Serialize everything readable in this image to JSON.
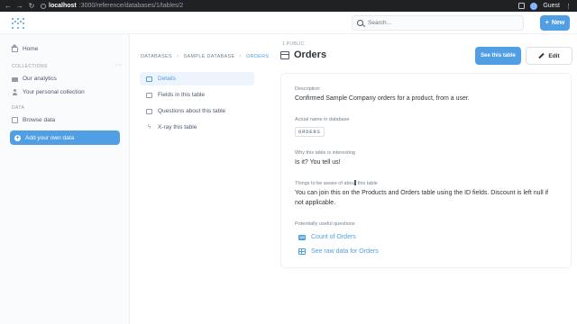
{
  "browser": {
    "host": "localhost",
    "path": ":3000/reference/databases/1/tables/2",
    "profile": "Guest"
  },
  "header": {
    "search_placeholder": "Search…",
    "new_label": "New"
  },
  "sidebar": {
    "home": "Home",
    "collections_heading": "COLLECTIONS",
    "collections": [
      {
        "label": "Our analytics",
        "icon": "folder-icon"
      },
      {
        "label": "Your personal collection",
        "icon": "person-icon"
      }
    ],
    "data_heading": "DATA",
    "browse_data": "Browse data",
    "add_data": "Add your own data"
  },
  "breadcrumb": [
    "DATABASES",
    "SAMPLE DATABASE",
    "ORDERS"
  ],
  "ref_nav": [
    {
      "label": "Details",
      "selected": true
    },
    {
      "label": "Fields in this table",
      "selected": false
    },
    {
      "label": "Questions about this table",
      "selected": false
    },
    {
      "label": "X-ray this table",
      "selected": false
    }
  ],
  "table": {
    "schema": "1.PUBLIC",
    "title": "Orders",
    "see_button": "See this table",
    "edit_button": "Edit"
  },
  "details": {
    "description_label": "Description",
    "description": "Confirmed Sample Company orders for a product, from a user.",
    "actual_name_label": "Actual name in database",
    "actual_name": "ORDERS",
    "interesting_label": "Why this table is interesting",
    "interesting": "Is it? You tell us!",
    "aware_label": "Things to be aware of about this table",
    "aware": "You can join this on the Products and Orders table using the ID fields. Discount is left null if not applicable.",
    "useful_label": "Potentially useful questions",
    "useful": [
      "Count of Orders",
      "See raw data for Orders"
    ]
  },
  "colors": {
    "brand": "#509ee3",
    "text_dark": "#2e353b",
    "text_muted": "#74838f"
  }
}
